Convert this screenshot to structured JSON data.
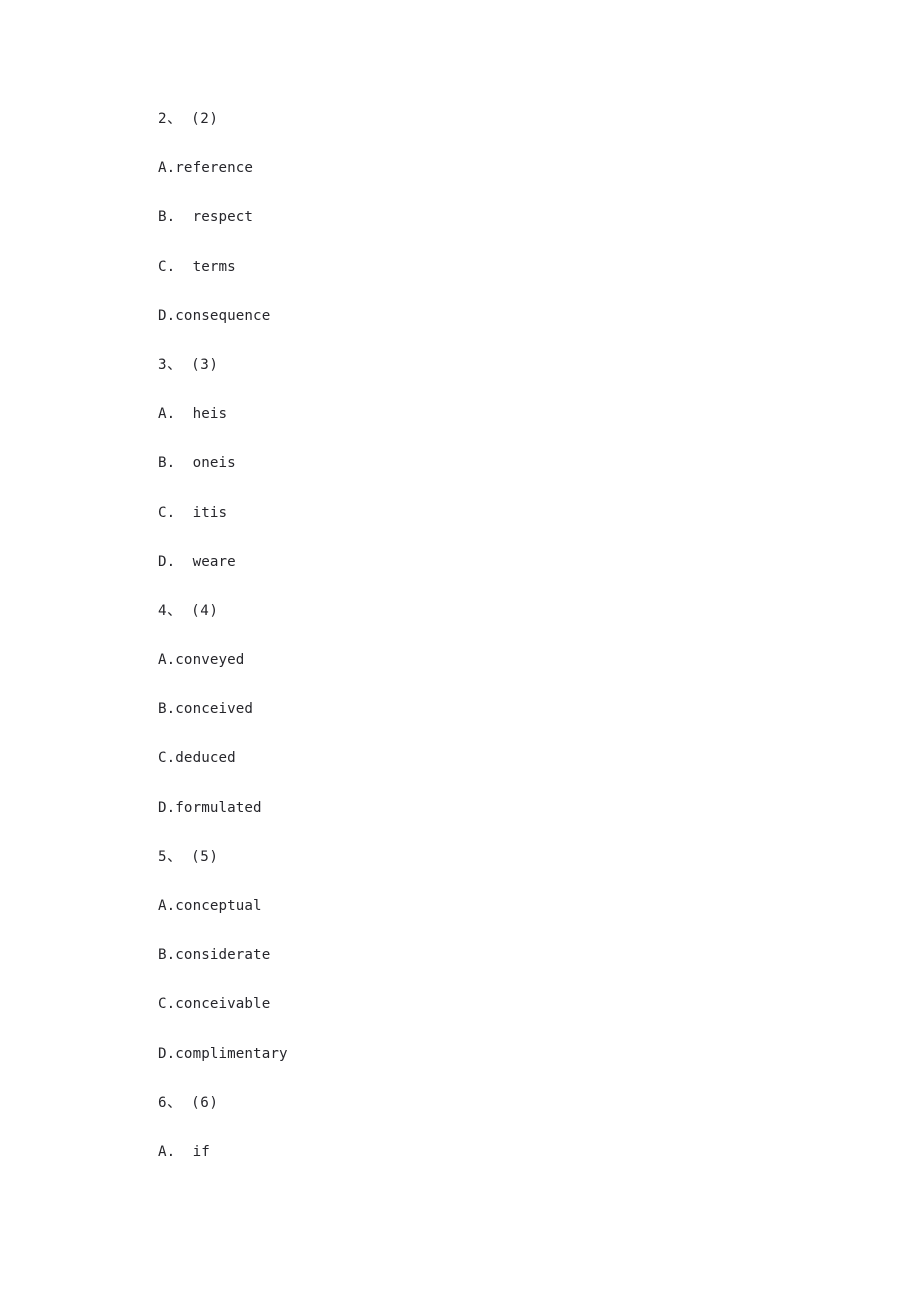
{
  "document": {
    "page_background": "#ffffff",
    "text_color": "#26262b",
    "lines": [
      {
        "id": "q2-number",
        "kind": "question",
        "text": "2、 (2)"
      },
      {
        "id": "q2-opt-a",
        "kind": "option",
        "text": "A.reference"
      },
      {
        "id": "q2-opt-b",
        "kind": "option",
        "text": "B.  respect"
      },
      {
        "id": "q2-opt-c",
        "kind": "option",
        "text": "C.  terms"
      },
      {
        "id": "q2-opt-d",
        "kind": "option",
        "text": "D.consequence"
      },
      {
        "id": "q3-number",
        "kind": "question",
        "text": "3、 (3)"
      },
      {
        "id": "q3-opt-a",
        "kind": "option",
        "text": "A.  heis"
      },
      {
        "id": "q3-opt-b",
        "kind": "option",
        "text": "B.  oneis"
      },
      {
        "id": "q3-opt-c",
        "kind": "option",
        "text": "C.  itis"
      },
      {
        "id": "q3-opt-d",
        "kind": "option",
        "text": "D.  weare"
      },
      {
        "id": "q4-number",
        "kind": "question",
        "text": "4、 (4)"
      },
      {
        "id": "q4-opt-a",
        "kind": "option",
        "text": "A.conveyed"
      },
      {
        "id": "q4-opt-b",
        "kind": "option",
        "text": "B.conceived"
      },
      {
        "id": "q4-opt-c",
        "kind": "option",
        "text": "C.deduced"
      },
      {
        "id": "q4-opt-d",
        "kind": "option",
        "text": "D.formulated"
      },
      {
        "id": "q5-number",
        "kind": "question",
        "text": "5、 (5)"
      },
      {
        "id": "q5-opt-a",
        "kind": "option",
        "text": "A.conceptual"
      },
      {
        "id": "q5-opt-b",
        "kind": "option",
        "text": "B.considerate"
      },
      {
        "id": "q5-opt-c",
        "kind": "option",
        "text": "C.conceivable"
      },
      {
        "id": "q5-opt-d",
        "kind": "option",
        "text": "D.complimentary"
      },
      {
        "id": "q6-number",
        "kind": "question",
        "text": "6、 (6)"
      },
      {
        "id": "q6-opt-a",
        "kind": "option",
        "text": "A.  if"
      }
    ]
  }
}
